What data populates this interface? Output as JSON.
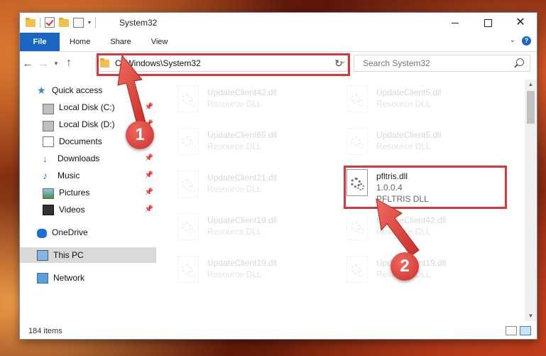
{
  "window": {
    "title": "System32",
    "controls": {
      "minimize": "minimize",
      "maximize": "maximize",
      "close": "close"
    }
  },
  "ribbon": {
    "tabs": [
      "File",
      "Home",
      "Share",
      "View"
    ]
  },
  "nav": {
    "address": "C:\\Windows\\System32",
    "search_placeholder": "Search System32"
  },
  "sidebar": {
    "items": [
      {
        "label": "Quick access",
        "icon": "star-icon",
        "pinned": false
      },
      {
        "label": "Local Disk (C:)",
        "icon": "disk-icon",
        "pinned": true
      },
      {
        "label": "Local Disk (D:)",
        "icon": "disk-icon",
        "pinned": true
      },
      {
        "label": "Documents",
        "icon": "document-icon",
        "pinned": true
      },
      {
        "label": "Downloads",
        "icon": "download-icon",
        "pinned": true
      },
      {
        "label": "Music",
        "icon": "music-icon",
        "pinned": true
      },
      {
        "label": "Pictures",
        "icon": "pictures-icon",
        "pinned": true
      },
      {
        "label": "Videos",
        "icon": "video-icon",
        "pinned": true
      },
      {
        "label": "OneDrive",
        "icon": "cloud-icon",
        "pinned": false
      },
      {
        "label": "This PC",
        "icon": "computer-icon",
        "pinned": false,
        "selected": true
      },
      {
        "label": "Network",
        "icon": "network-icon",
        "pinned": false
      }
    ]
  },
  "files": [
    {
      "name": "UpdateClient42.dll",
      "sub1": "Resource DLL",
      "sub2": ""
    },
    {
      "name": "UpdateClient5.dll",
      "sub1": "Resource DLL",
      "sub2": ""
    },
    {
      "name": "UpdateClient65.dll",
      "sub1": "Resource DLL",
      "sub2": ""
    },
    {
      "name": "UpdateClient5.dll",
      "sub1": "Resource DLL",
      "sub2": ""
    },
    {
      "name": "UpdateClient21.dll",
      "sub1": "Resource DLL",
      "sub2": ""
    },
    {
      "name": "pfltris.dll",
      "sub1": "1.0.0.4",
      "sub2": "PFLTRIS DLL"
    },
    {
      "name": "UpdateClient19.dll",
      "sub1": "Resource DLL",
      "sub2": ""
    },
    {
      "name": "UpdateClient42.dll",
      "sub1": "Resource DLL",
      "sub2": ""
    },
    {
      "name": "UpdateClient19.dll",
      "sub1": "Resource DLL",
      "sub2": ""
    },
    {
      "name": "UpdateClient19.dll",
      "sub1": "Resource DLL",
      "sub2": ""
    }
  ],
  "status": {
    "count": "184 items"
  },
  "annotations": {
    "step1": "1",
    "step2": "2",
    "highlight_color": "#d6393b"
  }
}
